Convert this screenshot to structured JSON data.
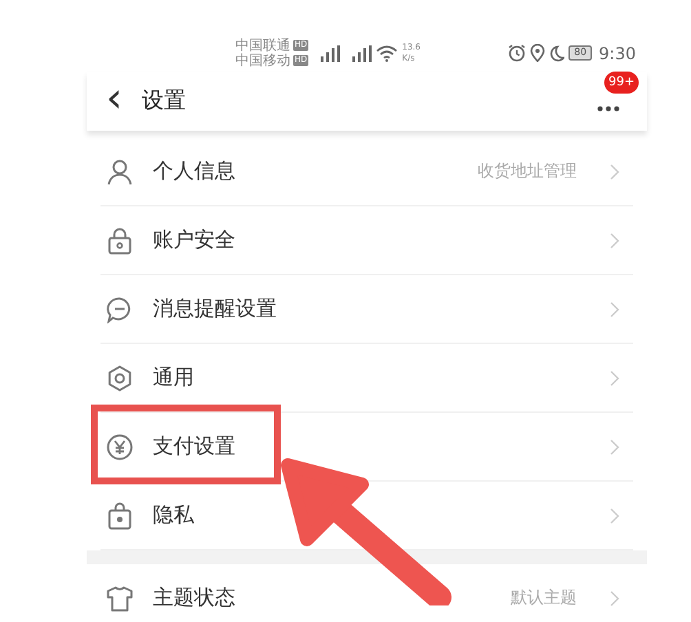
{
  "status_bar": {
    "carriers": [
      {
        "name": "中国联通",
        "badge": "HD"
      },
      {
        "name": "中国移动",
        "badge": "HD"
      }
    ],
    "speed": [
      "13.6",
      "K/s"
    ],
    "battery": "80",
    "time": "9:30"
  },
  "header": {
    "back": "‹",
    "title": "设置",
    "notification_count": "99+"
  },
  "groups": [
    {
      "items": [
        {
          "kind": "person",
          "label": "个人信息",
          "value": "收货地址管理"
        },
        {
          "kind": "lock",
          "label": "账户安全"
        },
        {
          "kind": "message",
          "label": "消息提醒设置"
        },
        {
          "kind": "gear",
          "label": "通用"
        },
        {
          "kind": "yen",
          "label": "支付设置",
          "highlighted": true
        },
        {
          "kind": "privacy",
          "label": "隐私"
        }
      ]
    },
    {
      "items": [
        {
          "kind": "shirt",
          "label": "主题状态",
          "value": "默认主题"
        }
      ]
    }
  ]
}
